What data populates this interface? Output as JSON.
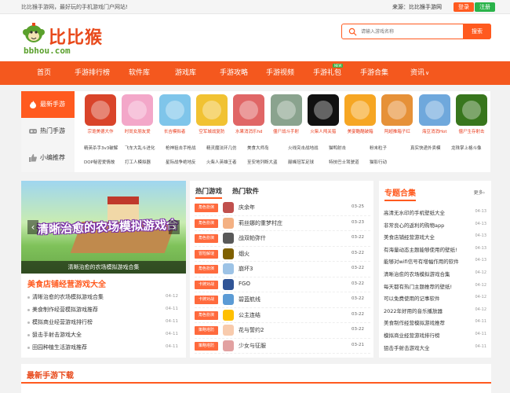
{
  "topbar": {
    "welcome": "比比猴手游网，最好玩的手机游戏门户网站!",
    "source": "来源：比比猴手游网",
    "login": "登录",
    "register": "注册"
  },
  "logo": {
    "title": "比比猴",
    "domain": "bbhou.com"
  },
  "search": {
    "placeholder": "请输入游戏名称",
    "button": "搜索"
  },
  "nav": {
    "items": [
      "首页",
      "手游排行榜",
      "软件库",
      "游戏库",
      "手游攻略",
      "手游视频",
      "手游礼包",
      "手游合集",
      "资讯"
    ],
    "new_tag": "NEW",
    "more_arrow": "∨"
  },
  "side_tabs": [
    "最新手游",
    "热门手游",
    "小编推荐"
  ],
  "featured_games": [
    {
      "name": "宗诡美德大作",
      "color": "#d9442a"
    },
    {
      "name": "时尚女朋友爱",
      "color": "#f3a7c9"
    },
    {
      "name": "长吉模拟者",
      "color": "#7fc5ea"
    },
    {
      "name": "空军城战复防",
      "color": "#f1c232"
    },
    {
      "name": "水果消消乐hd",
      "color": "#e06666"
    },
    {
      "name": "僵尸战斗手射",
      "color": "#8aa38e"
    },
    {
      "name": "火柴人闯关猎",
      "color": "#111111"
    },
    {
      "name": "美宴酷酷破箱",
      "color": "#f6a623"
    },
    {
      "name": "阿超推箱子红",
      "color": "#e69138"
    },
    {
      "name": "海豆消消Hot",
      "color": "#6fa8dc"
    },
    {
      "name": "僵尸生存射击",
      "color": "#38761d"
    }
  ],
  "small_rows": [
    [
      "精英杀手3v3破解",
      "飞车大乱斗进化",
      "枪神狙击手枪战",
      "精灵魔法环几仿",
      "美食大师岛",
      "火线突击战地战",
      "猫鸭射击",
      "粉末粒子",
      "真实快递外卖模",
      "龙珠掌上格斗像"
    ],
    [
      "DOP秘密爱情故",
      "打工人模拟器",
      "星际战争绝地反",
      "火柴人英雄王者",
      "至安地列断大盗",
      "巅峰冠军足球",
      "特技巴士驾驶道",
      "猫影行动"
    ]
  ],
  "banner": {
    "headline": "清晰治愈的农场模拟游戏合",
    "caption": "清晰治愈的农场模拟游戏合集",
    "prev": "‹",
    "next": "›"
  },
  "feature": {
    "title": "美食店铺经营游戏大全",
    "items": [
      {
        "title": "清晰治愈的农场模拟游戏合集",
        "date": "04-12"
      },
      {
        "title": "美食制作经营模拟游戏推荐",
        "date": "04-11"
      },
      {
        "title": "模拟商业经营游戏排行榜",
        "date": "04-11"
      },
      {
        "title": "狙击手射击游戏大全",
        "date": "04-11"
      },
      {
        "title": "田园种植生活游戏推荐",
        "date": "04-11"
      }
    ]
  },
  "hot": {
    "tabs": [
      "热门游戏",
      "热门软件"
    ],
    "rows": [
      {
        "tag": "角色扮演",
        "name": "庆余年",
        "date": "03-25",
        "color": "#c0504d"
      },
      {
        "tag": "角色扮演",
        "name": "莉丝娜的重梦村庄",
        "date": "03-23",
        "color": "#f4b183"
      },
      {
        "tag": "角色扮演",
        "name": "战双帕弥什",
        "date": "03-22",
        "color": "#595959"
      },
      {
        "tag": "冒险解谜",
        "name": "烟火",
        "date": "03-22",
        "color": "#7f6000"
      },
      {
        "tag": "角色扮演",
        "name": "崩坏3",
        "date": "03-22",
        "color": "#9dc3e6"
      },
      {
        "tag": "卡牌对战",
        "name": "FGO",
        "date": "03-22",
        "color": "#305496"
      },
      {
        "tag": "卡牌对战",
        "name": "碧蓝航线",
        "date": "03-22",
        "color": "#5b9bd5"
      },
      {
        "tag": "角色扮演",
        "name": "公主连结",
        "date": "03-22",
        "color": "#ffc000"
      },
      {
        "tag": "策略塔防",
        "name": "花与誓约2",
        "date": "03-22",
        "color": "#f8cbad"
      },
      {
        "tag": "策略塔防",
        "name": "少女与征服",
        "date": "03-21",
        "color": "#e2a1a1"
      }
    ]
  },
  "topic": {
    "title": "专题合集",
    "more": "更多›",
    "rows": [
      {
        "title": "高清无水印的手机壁纸大全",
        "date": "04-13"
      },
      {
        "title": "非常良心的返利的购物app",
        "date": "04-13"
      },
      {
        "title": "美食店铺经营游戏大全",
        "date": "04-13"
      },
      {
        "title": "有海量动态主题能够使用的壁纸!",
        "date": "04-13"
      },
      {
        "title": "能够对wifi信号有增幅作用的软件",
        "date": "04-13"
      },
      {
        "title": "清晰治愈的农场模拟游戏合集",
        "date": "04-12"
      },
      {
        "title": "每天都有热门主题推荐的壁纸!",
        "date": "04-12"
      },
      {
        "title": "可以免费使用的记事软件",
        "date": "04-12"
      },
      {
        "title": "2022年好用的音乐播放器",
        "date": "04-12"
      },
      {
        "title": "美食制作经营模拟游戏推荐",
        "date": "04-11"
      },
      {
        "title": "模拟商业经营游戏排行榜",
        "date": "04-11"
      },
      {
        "title": "狙击手射击游戏大全",
        "date": "04-11"
      }
    ]
  },
  "bottom": {
    "title": "最新手游下载"
  }
}
